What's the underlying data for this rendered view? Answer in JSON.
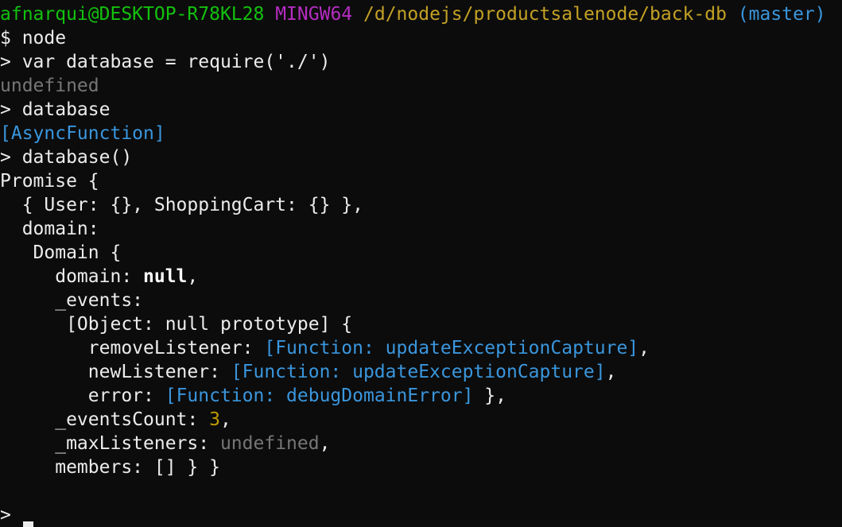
{
  "terminal": {
    "default_color": "#ececec",
    "lines": [
      {
        "segments": [
          {
            "text": "afnarqui@DESKTOP-R78KL28",
            "color": "#13c10e"
          },
          {
            "text": " ",
            "color": "#ececec"
          },
          {
            "text": "MINGW64",
            "color": "#b52cc1"
          },
          {
            "text": " ",
            "color": "#ececec"
          },
          {
            "text": "/d/nodejs/productsalenode/back-db",
            "color": "#c3a125"
          },
          {
            "text": " ",
            "color": "#ececec"
          },
          {
            "text": "(master)",
            "color": "#3a96dd"
          }
        ]
      },
      {
        "segments": [
          {
            "text": "$ node",
            "color": "#ececec"
          }
        ]
      },
      {
        "segments": [
          {
            "text": "> var database = require('./')",
            "color": "#ececec"
          }
        ]
      },
      {
        "segments": [
          {
            "text": "undefined",
            "color": "#767676"
          }
        ]
      },
      {
        "segments": [
          {
            "text": "> database",
            "color": "#ececec"
          }
        ]
      },
      {
        "segments": [
          {
            "text": "[AsyncFunction]",
            "color": "#3a96dd"
          }
        ]
      },
      {
        "segments": [
          {
            "text": "> database()",
            "color": "#ececec"
          }
        ]
      },
      {
        "segments": [
          {
            "text": "Promise {",
            "color": "#ececec"
          }
        ]
      },
      {
        "segments": [
          {
            "text": "  { User: {}, ShoppingCart: {} },",
            "color": "#ececec"
          }
        ]
      },
      {
        "segments": [
          {
            "text": "  domain:",
            "color": "#ececec"
          }
        ]
      },
      {
        "segments": [
          {
            "text": "   Domain {",
            "color": "#ececec"
          }
        ]
      },
      {
        "segments": [
          {
            "text": "     domain: ",
            "color": "#ececec"
          },
          {
            "text": "null",
            "color": "#ffffff",
            "bold": true
          },
          {
            "text": ",",
            "color": "#ececec"
          }
        ]
      },
      {
        "segments": [
          {
            "text": "     _events:",
            "color": "#ececec"
          }
        ]
      },
      {
        "segments": [
          {
            "text": "      [Object: null prototype] {",
            "color": "#ececec"
          }
        ]
      },
      {
        "segments": [
          {
            "text": "        removeListener: ",
            "color": "#ececec"
          },
          {
            "text": "[Function: updateExceptionCapture]",
            "color": "#3a96dd"
          },
          {
            "text": ",",
            "color": "#ececec"
          }
        ]
      },
      {
        "segments": [
          {
            "text": "        newListener: ",
            "color": "#ececec"
          },
          {
            "text": "[Function: updateExceptionCapture]",
            "color": "#3a96dd"
          },
          {
            "text": ",",
            "color": "#ececec"
          }
        ]
      },
      {
        "segments": [
          {
            "text": "        error: ",
            "color": "#ececec"
          },
          {
            "text": "[Function: debugDomainError]",
            "color": "#3a96dd"
          },
          {
            "text": " },",
            "color": "#ececec"
          }
        ]
      },
      {
        "segments": [
          {
            "text": "     _eventsCount: ",
            "color": "#ececec"
          },
          {
            "text": "3",
            "color": "#c19c00"
          },
          {
            "text": ",",
            "color": "#ececec"
          }
        ]
      },
      {
        "segments": [
          {
            "text": "     _maxListeners: ",
            "color": "#ececec"
          },
          {
            "text": "undefined",
            "color": "#767676"
          },
          {
            "text": ",",
            "color": "#ececec"
          }
        ]
      },
      {
        "segments": [
          {
            "text": "     members: [] } }",
            "color": "#ececec"
          }
        ]
      },
      {
        "segments": [
          {
            "text": "",
            "color": "#ececec"
          }
        ]
      },
      {
        "segments": [
          {
            "text": "> ",
            "color": "#ececec"
          }
        ],
        "cursor": true
      }
    ]
  }
}
